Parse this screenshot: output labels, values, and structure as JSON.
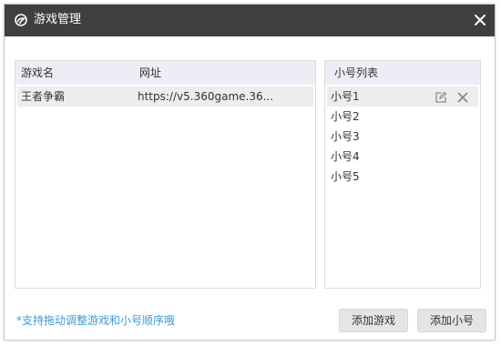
{
  "window": {
    "title": "游戏管理",
    "logo_icon": "360-logo-icon",
    "close_icon": "close-icon"
  },
  "games_table": {
    "columns": [
      "游戏名",
      "网址"
    ],
    "rows": [
      {
        "name": "王者争霸",
        "url": "https://v5.360game.36..."
      }
    ]
  },
  "accounts": {
    "title": "小号列表",
    "items": [
      "小号1",
      "小号2",
      "小号3",
      "小号4",
      "小号5"
    ],
    "selected_index": 0,
    "actions": [
      "edit-icon",
      "delete-icon"
    ]
  },
  "footer": {
    "hint": "*支持拖动调整游戏和小号顺序哦",
    "add_game_label": "添加游戏",
    "add_account_label": "添加小号"
  },
  "colors": {
    "titlebar": "#3f3f3f",
    "header_bg": "#edeef5",
    "selected_row": "#ededed",
    "hint_text": "#3c9ad6",
    "button_bg": "#e5e5e5"
  }
}
